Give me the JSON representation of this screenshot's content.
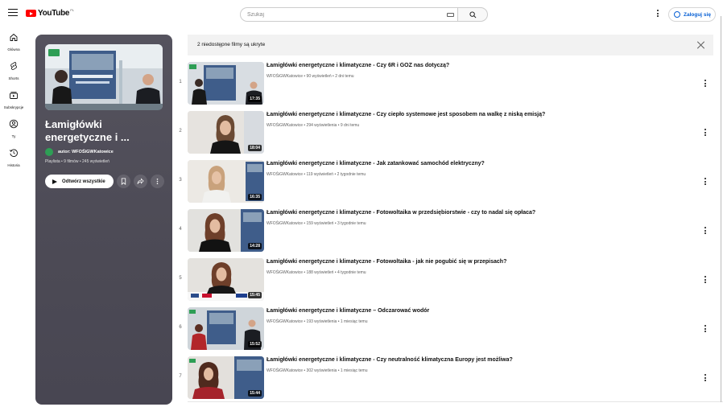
{
  "header": {
    "logo_text": "YouTube",
    "region": "PL",
    "search_placeholder": "Szukaj",
    "signin_label": "Zaloguj się"
  },
  "sidebar": {
    "items": [
      {
        "label": "Główna",
        "icon": "home-icon"
      },
      {
        "label": "Shorts",
        "icon": "shorts-icon"
      },
      {
        "label": "Subskrypcje",
        "icon": "subscriptions-icon"
      },
      {
        "label": "Ty",
        "icon": "you-icon"
      },
      {
        "label": "Historia",
        "icon": "history-icon"
      }
    ]
  },
  "playlist": {
    "title": "Łamigłówki energetyczne i ...",
    "author": "autor: WFOŚiGWKatowice",
    "meta": "Playlista • 9 filmów • 245 wyświetleń",
    "play_all_label": "Odtwórz wszystkie"
  },
  "notice": {
    "text": "2 niedostępne filmy są ukryte"
  },
  "videos": [
    {
      "index": "1",
      "title": "Łamigłówki energetyczne i klimatyczne - Czy 6R i GOZ nas dotyczą?",
      "meta": "WFOŚiGWKatowice • 90 wyświetleń • 2 dni temu",
      "duration": "17:35"
    },
    {
      "index": "2",
      "title": "Łamigłówki energetyczne i klimatyczne - Czy ciepło systemowe jest sposobem na walkę z niską emisją?",
      "meta": "WFOŚiGWKatowice • 294 wyświetlenia • 9 dni temu",
      "duration": "18:04"
    },
    {
      "index": "3",
      "title": "Łamigłówki energetyczne i klimatyczne - Jak zatankować samochód elektryczny?",
      "meta": "WFOŚiGWKatowice • 119 wyświetleń • 2 tygodnie temu",
      "duration": "16:35"
    },
    {
      "index": "4",
      "title": "Łamigłówki energetyczne i klimatyczne - Fotowoltaika w przedsiębiorstwie - czy to nadal się opłaca?",
      "meta": "WFOŚiGWKatowice • 159 wyświetleń • 3 tygodnie temu",
      "duration": "14:28"
    },
    {
      "index": "5",
      "title": "Łamigłówki energetyczne i klimatyczne - Fotowoltaika - jak nie pogubić się w przepisach?",
      "meta": "WFOŚiGWKatowice • 188 wyświetleń • 4 tygodnie temu",
      "duration": "15:45"
    },
    {
      "index": "6",
      "title": "Łamigłówki energetyczne i klimatyczne – Odczarować wodór",
      "meta": "WFOŚiGWKatowice • 193 wyświetlenia • 1 miesiąc temu",
      "duration": "15:52"
    },
    {
      "index": "7",
      "title": "Łamigłówki energetyczne i klimatyczne - Czy neutralność klimatyczna Europy jest możliwa?",
      "meta": "WFOŚiGWKatowice • 302 wyświetlenia • 1 miesiąc temu",
      "duration": "15:44"
    }
  ],
  "colors": {
    "brand_red": "#ff0000",
    "link_blue": "#065fd4",
    "panel_bg": "#4e4c57"
  }
}
